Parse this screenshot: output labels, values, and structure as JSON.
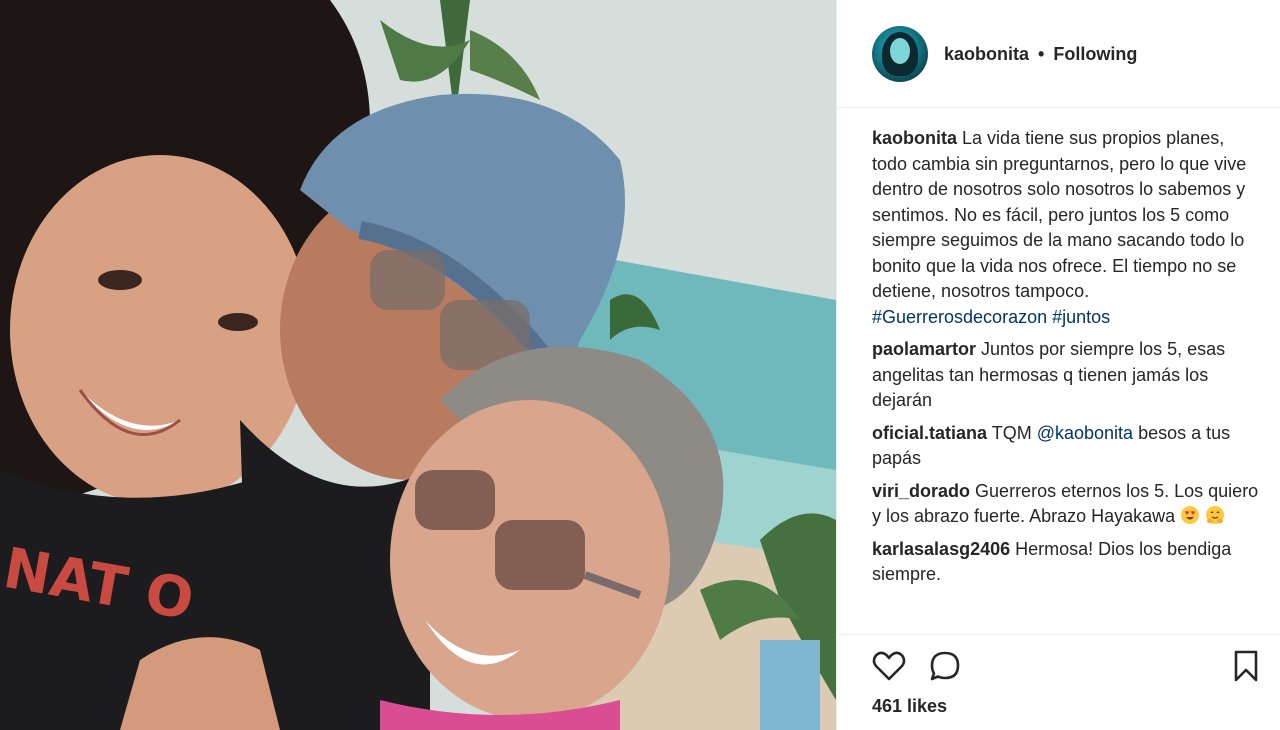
{
  "post": {
    "author": "kaobonita",
    "separator": "•",
    "follow_status": "Following",
    "caption": {
      "user": "kaobonita",
      "text": "La vida tiene sus propios planes, todo cambia sin preguntarnos, pero lo que vive dentro de nosotros solo nosotros lo sabemos y sentimos. No es fácil, pero juntos los 5 como siempre seguimos de la mano sacando todo lo bonito que la vida nos ofrece. El tiempo no se detiene, nosotros tampoco.",
      "hashtag1": "#Guerrerosdecorazon",
      "hashtag2": "#juntos"
    },
    "comments": [
      {
        "user": "paolamartor",
        "text": "Juntos por siempre los 5, esas angelitas tan hermosas q tienen jamás los dejarán"
      },
      {
        "user": "oficial.tatiana",
        "text_before": "TQM",
        "mention": "@kaobonita",
        "text_after": "besos a tus papás"
      },
      {
        "user": "viri_dorado",
        "text": "Guerreros eternos los 5. Los quiero y los abrazo fuerte. Abrazo Hayakawa"
      },
      {
        "user": "karlasalasg2406",
        "text": "Hermosa! Dios los bendiga siempre."
      }
    ],
    "likes": "461 likes"
  },
  "icons": {
    "like": "heart-icon",
    "comment": "comment-bubble-icon",
    "save": "bookmark-icon",
    "emoji1": "heart-eyes-emoji",
    "emoji2": "hugging-emoji"
  },
  "colors": {
    "text": "#262626",
    "link": "#003569",
    "divider": "#efefef"
  }
}
